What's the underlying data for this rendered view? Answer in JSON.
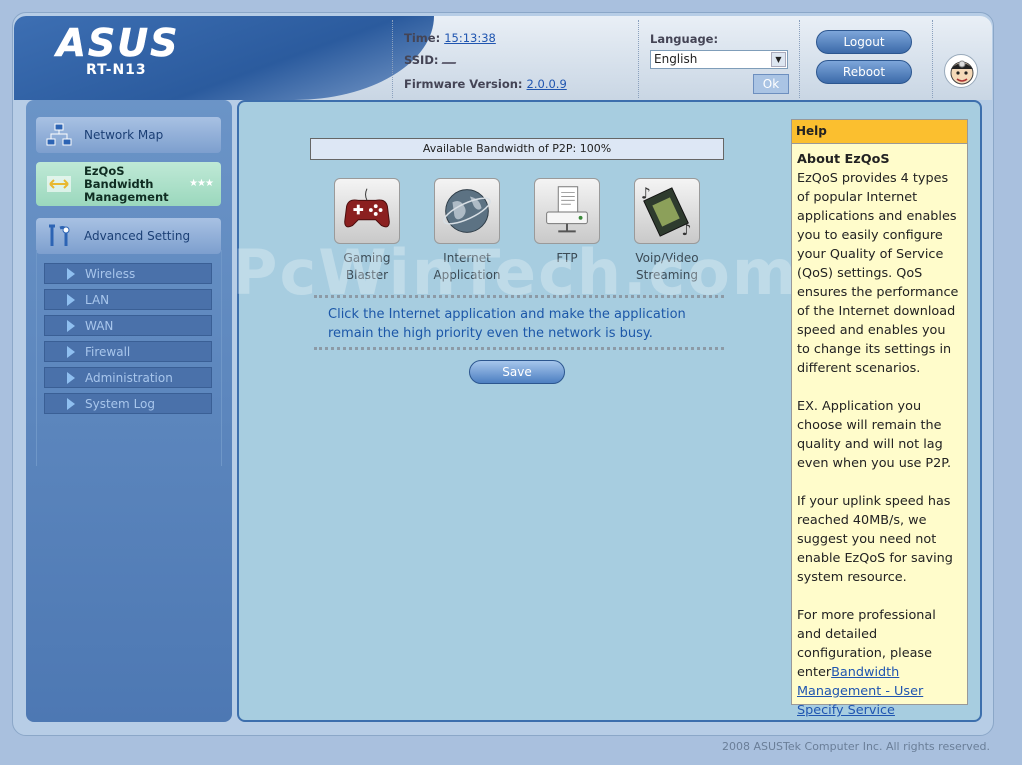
{
  "header": {
    "brand": "ASUS",
    "model": "RT-N13",
    "time_label": "Time:",
    "time_value": "15:13:38",
    "ssid_label": "SSID:",
    "firmware_label": "Firmware Version:",
    "firmware_value": "2.0.0.9",
    "language_label": "Language:",
    "language_value": "English",
    "ok_label": "Ok",
    "logout_label": "Logout",
    "reboot_label": "Reboot"
  },
  "sidebar": {
    "network_map": "Network Map",
    "ezqos_line1": "EzQoS",
    "ezqos_line2": "Bandwidth",
    "ezqos_line3": "Management",
    "ezqos_stars": "★★★",
    "advanced": "Advanced Setting",
    "sub_items": [
      "Wireless",
      "LAN",
      "WAN",
      "Firewall",
      "Administration",
      "System Log"
    ]
  },
  "main": {
    "bandwidth_text": "Available Bandwidth of P2P: 100%",
    "apps": [
      {
        "line1": "Gaming Blaster",
        "line2": ""
      },
      {
        "line1": "Internet",
        "line2": "Application"
      },
      {
        "line1": "FTP",
        "line2": ""
      },
      {
        "line1": "Voip/Video",
        "line2": "Streaming"
      }
    ],
    "instruction": "Click the Internet application and make the application remain the high priority even the network is busy.",
    "save_label": "Save"
  },
  "help": {
    "title": "Help",
    "heading": "About EzQoS",
    "p1": "EzQoS provides 4 types of popular Internet applications and enables you to easily configure your Quality of Service (QoS) settings. QoS ensures the performance of the Internet download speed and enables you to change its settings in different scenarios.",
    "p2": "EX. Application you choose will remain the quality and will not lag even when you use P2P.",
    "p3": "If your uplink speed has reached 40MB/s, we suggest you need not enable EzQoS for saving system resource.",
    "p4_text": "For more professional and detailed configuration, please enter",
    "p4_link": "Bandwidth Management - User Specify Service"
  },
  "watermark": "PcWinTech.com",
  "footer": {
    "copyright": "2008 ASUSTek Computer Inc. All rights reserved."
  },
  "colors": {
    "accent_blue": "#3d6fad",
    "help_header": "#fbbf2f",
    "help_bg": "#fffccb",
    "ezqos_bg": "#bfe9d6",
    "main_bg": "#a7cde0"
  }
}
